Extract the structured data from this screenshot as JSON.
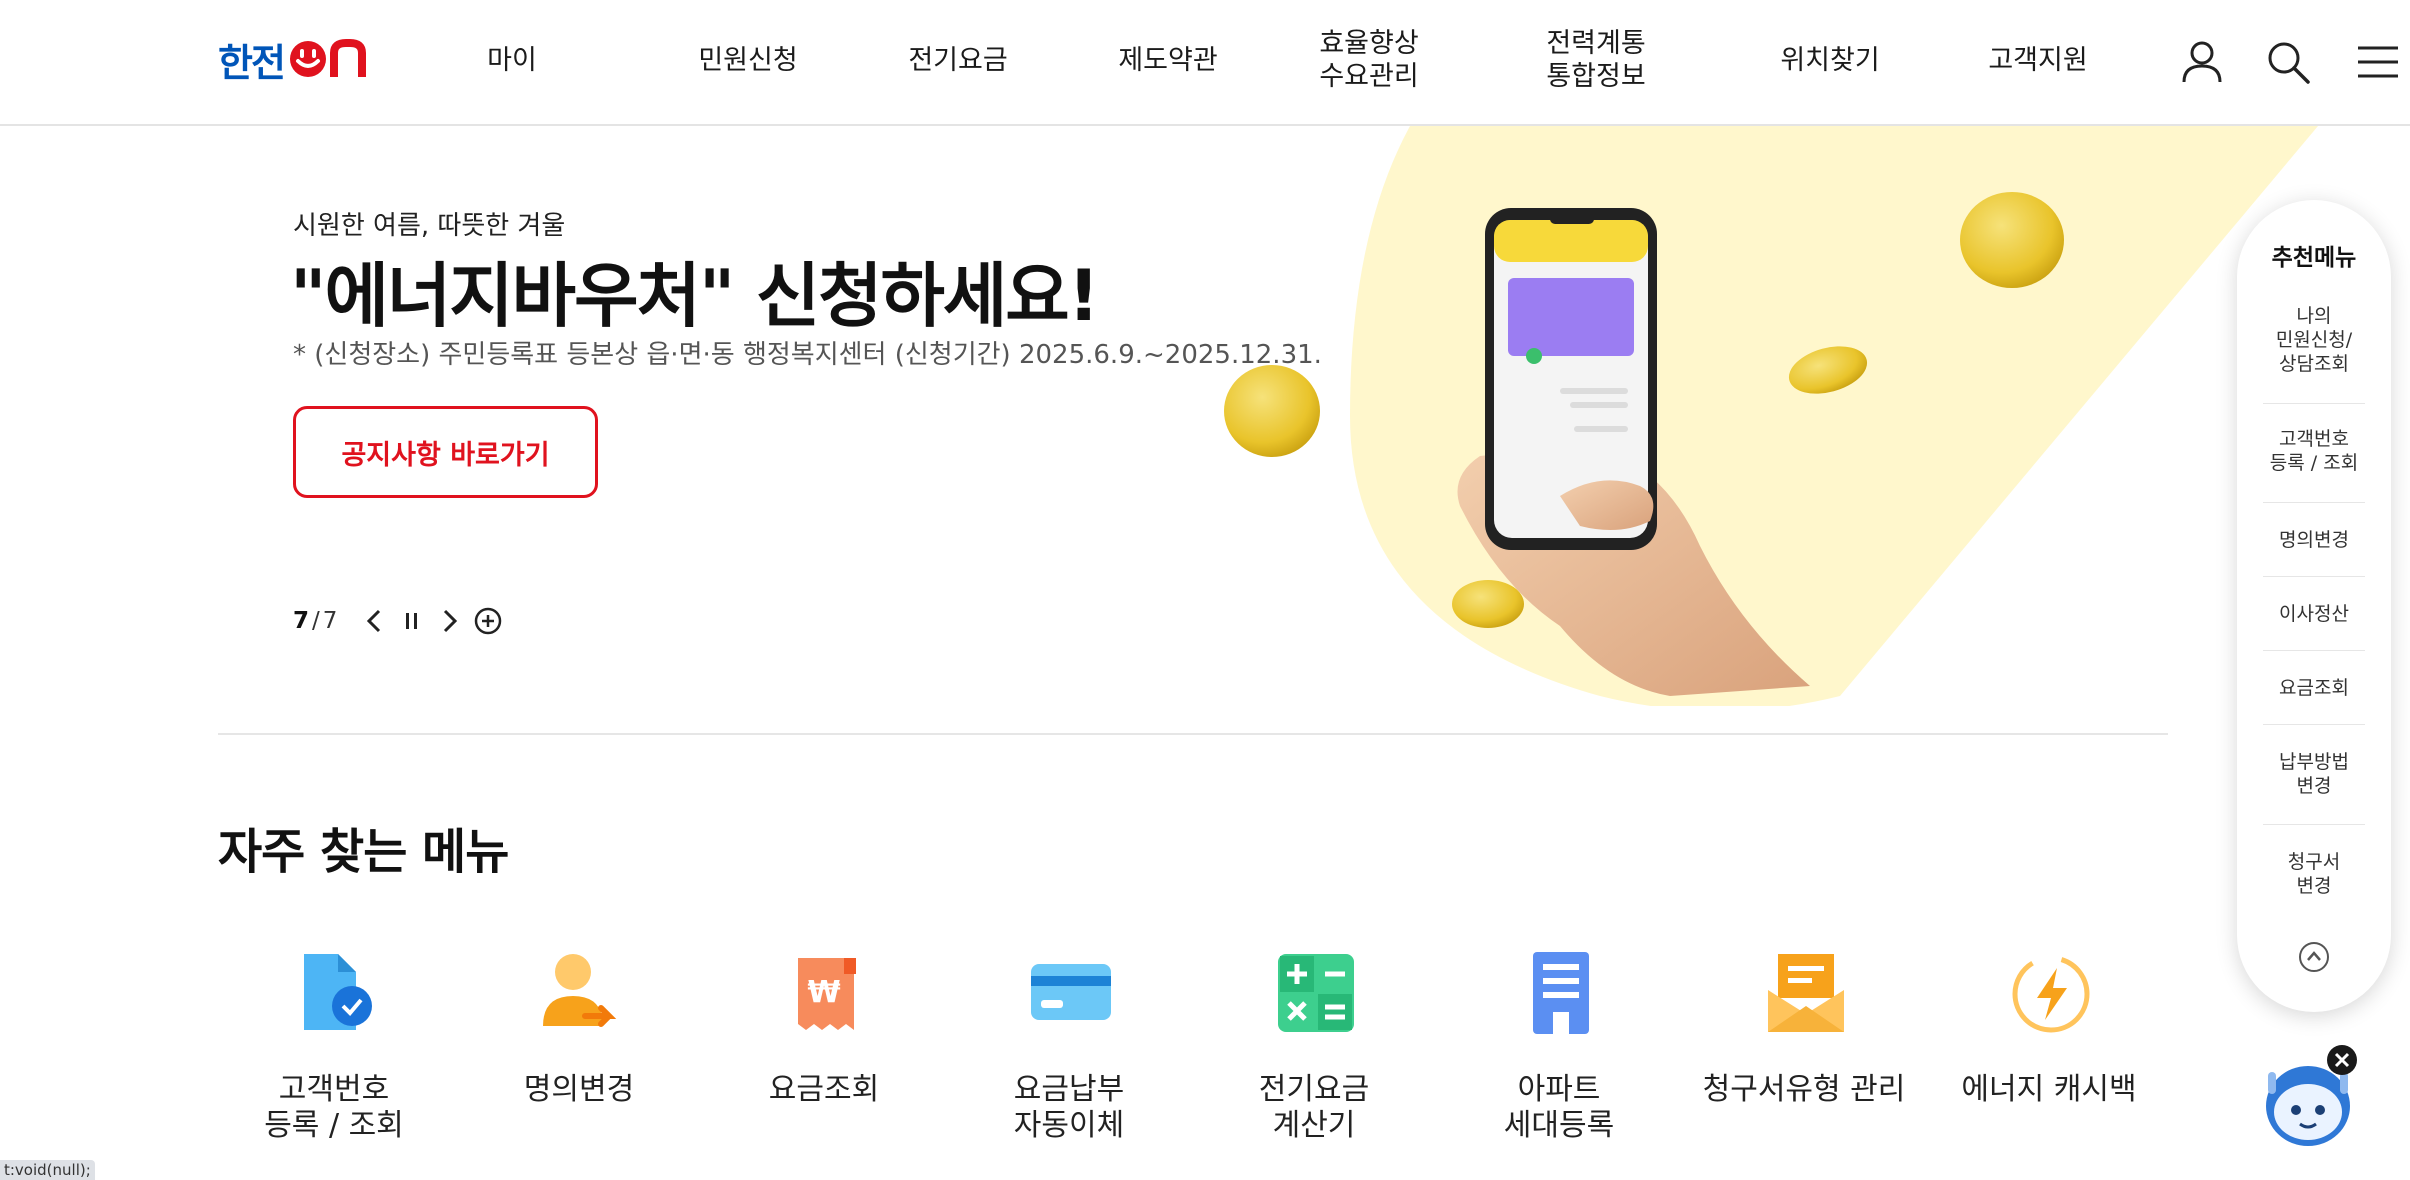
{
  "header": {
    "logo": {
      "text": "한전",
      "suffix": "ON"
    },
    "nav": [
      "마이",
      "민원신청",
      "전기요금",
      "제도약관",
      "효율향상\n수요관리",
      "전력계통\n통합정보",
      "위치찾기",
      "고객지원"
    ],
    "icons": [
      "user-icon",
      "search-icon",
      "menu-icon"
    ]
  },
  "hero": {
    "subtitle": "시원한 여름, 따뜻한 겨울",
    "title": "\"에너지바우처\" 신청하세요!",
    "note": "* (신청장소) 주민등록표 등본상 읍·면·동 행정복지센터 (신청기간) 2025.6.9.~2025.12.31.",
    "button": "공지사항 바로가기",
    "pager": {
      "current": "7",
      "separator": "/",
      "total": "7"
    }
  },
  "frequent": {
    "title": "자주 찾는 메뉴",
    "items": [
      {
        "label": "고객번호\n등록 / 조회",
        "icon": "document-check-icon"
      },
      {
        "label": "명의변경",
        "icon": "person-transfer-icon"
      },
      {
        "label": "요금조회",
        "icon": "won-receipt-icon"
      },
      {
        "label": "요금납부\n자동이체",
        "icon": "credit-card-icon"
      },
      {
        "label": "전기요금\n계산기",
        "icon": "calculator-icon"
      },
      {
        "label": "아파트\n세대등록",
        "icon": "apartment-icon"
      },
      {
        "label": "청구서유형 관리",
        "icon": "envelope-icon"
      },
      {
        "label": "에너지 캐시백",
        "icon": "lightning-icon"
      }
    ]
  },
  "side_menu": {
    "title": "추천메뉴",
    "items": [
      "나의\n민원신청/\n상담조회",
      "고객번호\n등록 / 조회",
      "명의변경",
      "이사정산",
      "요금조회",
      "납부방법\n변경",
      "청구서\n변경"
    ]
  },
  "status_bar": "t:void(null);",
  "colors": {
    "brand_blue": "#0055b8",
    "brand_red": "#e0121e",
    "hero_yellow": "#fff7cc"
  }
}
